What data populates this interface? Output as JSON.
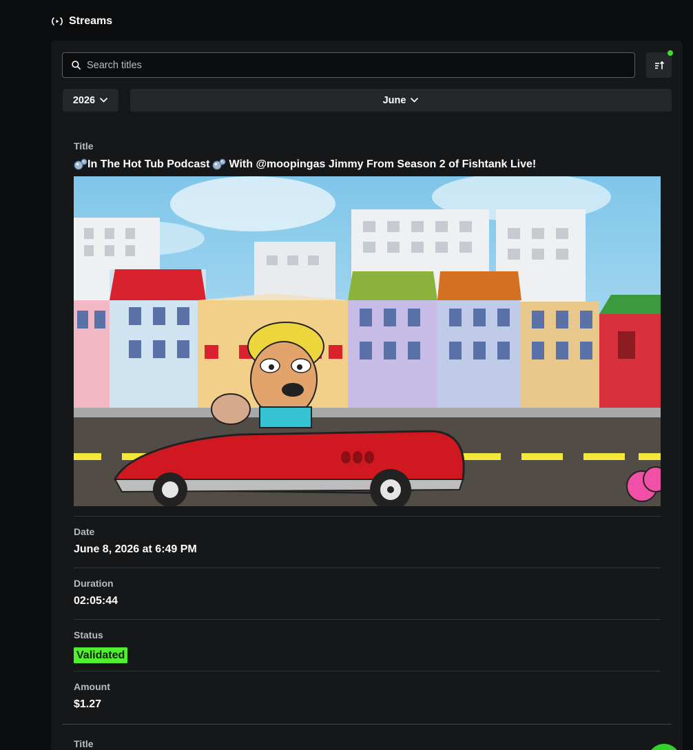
{
  "header": {
    "title": "Streams",
    "icon": "live-broadcast-icon"
  },
  "search": {
    "placeholder": "Search titles",
    "value": ""
  },
  "sort": {
    "icon": "sort-icon",
    "indicator_color": "#39e229"
  },
  "filters": {
    "year": "2026",
    "month": "June"
  },
  "streams": [
    {
      "title_label": "Title",
      "title": "In The Hot Tub Podcast",
      "title_mid": "With @moopingas Jimmy From Season 2 of Fishtank Live!",
      "title_icon": "bubbles-icon",
      "date_label": "Date",
      "date": "June 8, 2026 at 6:49 PM",
      "duration_label": "Duration",
      "duration": "02:05:44",
      "status_label": "Status",
      "status": "Validated",
      "status_color": "#4ff02f",
      "amount_label": "Amount",
      "amount": "$1.27"
    },
    {
      "title_label": "Title"
    }
  ],
  "colors": {
    "background": "#0b0c0d",
    "panel": "#151719",
    "control": "#25282b",
    "accent": "#39e229"
  }
}
